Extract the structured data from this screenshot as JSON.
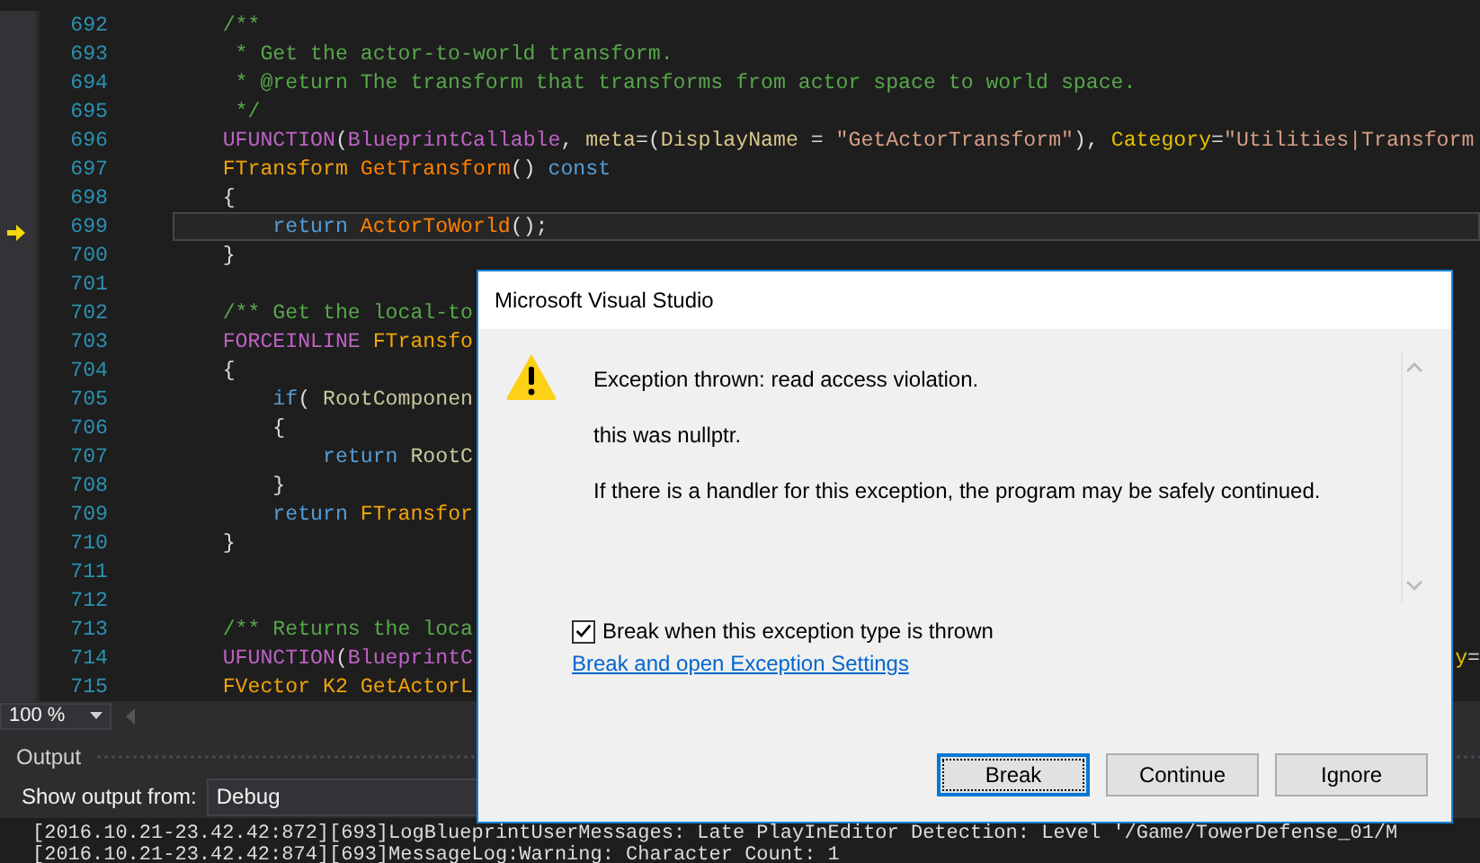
{
  "editor": {
    "lines": [
      {
        "number": "692",
        "tokens": [
          {
            "text": "    /**",
            "kind": "comment"
          }
        ]
      },
      {
        "number": "693",
        "tokens": [
          {
            "text": "     * Get the actor-to-world transform.",
            "kind": "comment"
          }
        ]
      },
      {
        "number": "694",
        "tokens": [
          {
            "text": "     * @return The transform that transforms from actor space to world space.",
            "kind": "comment"
          }
        ]
      },
      {
        "number": "695",
        "tokens": [
          {
            "text": "     */",
            "kind": "comment"
          }
        ]
      },
      {
        "number": "696",
        "tokens": [
          {
            "text": "    UFUNCTION",
            "kind": "macro"
          },
          {
            "text": "(",
            "kind": "plain"
          },
          {
            "text": "BlueprintCallable",
            "kind": "macro"
          },
          {
            "text": ", ",
            "kind": "plain"
          },
          {
            "text": "meta",
            "kind": "attr"
          },
          {
            "text": "=(",
            "kind": "plain"
          },
          {
            "text": "DisplayName",
            "kind": "attr"
          },
          {
            "text": " = ",
            "kind": "plain"
          },
          {
            "text": "\"GetActorTransform\"",
            "kind": "string"
          },
          {
            "text": "), ",
            "kind": "plain"
          },
          {
            "text": "Category",
            "kind": "key"
          },
          {
            "text": "=",
            "kind": "plain"
          },
          {
            "text": "\"Utilities|Transform",
            "kind": "string"
          }
        ]
      },
      {
        "number": "697",
        "tokens": [
          {
            "text": "    FTransform",
            "kind": "type"
          },
          {
            "text": " GetTransform",
            "kind": "function"
          },
          {
            "text": "() ",
            "kind": "plain"
          },
          {
            "text": "const",
            "kind": "keyword"
          }
        ]
      },
      {
        "number": "698",
        "tokens": [
          {
            "text": "    {",
            "kind": "plain"
          }
        ]
      },
      {
        "number": "699",
        "current": true,
        "tokens": [
          {
            "text": "        return",
            "kind": "keyword"
          },
          {
            "text": " ActorToWorld",
            "kind": "function"
          },
          {
            "text": "();",
            "kind": "plain"
          }
        ]
      },
      {
        "number": "700",
        "tokens": [
          {
            "text": "    }",
            "kind": "plain"
          }
        ]
      },
      {
        "number": "701"
      },
      {
        "number": "702",
        "tokens": [
          {
            "text": "    /** Get the local-to",
            "kind": "comment"
          }
        ]
      },
      {
        "number": "703",
        "tokens": [
          {
            "text": "    FORCEINLINE",
            "kind": "macro"
          },
          {
            "text": " FTransfo",
            "kind": "type"
          }
        ]
      },
      {
        "number": "704",
        "tokens": [
          {
            "text": "    {",
            "kind": "plain"
          }
        ]
      },
      {
        "number": "705",
        "tokens": [
          {
            "text": "        if",
            "kind": "keyword"
          },
          {
            "text": "( ",
            "kind": "plain"
          },
          {
            "text": "RootComponen",
            "kind": "variable"
          }
        ]
      },
      {
        "number": "706",
        "tokens": [
          {
            "text": "        {",
            "kind": "plain"
          }
        ]
      },
      {
        "number": "707",
        "tokens": [
          {
            "text": "            return",
            "kind": "keyword"
          },
          {
            "text": " RootC",
            "kind": "variable"
          }
        ]
      },
      {
        "number": "708",
        "tokens": [
          {
            "text": "        }",
            "kind": "plain"
          }
        ]
      },
      {
        "number": "709",
        "tokens": [
          {
            "text": "        return",
            "kind": "keyword"
          },
          {
            "text": " FTransfor",
            "kind": "type"
          }
        ]
      },
      {
        "number": "710",
        "tokens": [
          {
            "text": "    }",
            "kind": "plain"
          }
        ]
      },
      {
        "number": "711"
      },
      {
        "number": "712"
      },
      {
        "number": "713",
        "tokens": [
          {
            "text": "    /** Returns the loca",
            "kind": "comment"
          }
        ]
      },
      {
        "number": "714",
        "tokens": [
          {
            "text": "    UFUNCTION",
            "kind": "macro"
          },
          {
            "text": "(",
            "kind": "plain"
          },
          {
            "text": "BlueprintC",
            "kind": "macro"
          }
        ],
        "tail": [
          {
            "text": "y",
            "kind": "key"
          },
          {
            "text": "=",
            "kind": "plain"
          }
        ]
      },
      {
        "number": "715",
        "tokens": [
          {
            "text": "    FVector K2 GetActorL",
            "kind": "type"
          }
        ]
      }
    ],
    "zoom": "100 %"
  },
  "output": {
    "title": "Output",
    "source_label": "Show output from:",
    "source": "Debug",
    "lines": [
      "[2016.10.21-23.42.42:872][693]LogBlueprintUserMessages: Late PlayInEditor Detection: Level '/Game/TowerDefense_01/M",
      "[2016.10.21-23.42.42:874][693]MessageLog:Warning: Character Count: 1"
    ]
  },
  "dialog": {
    "title": "Microsoft Visual Studio",
    "messages": [
      "Exception thrown: read access violation.",
      "this was nullptr.",
      "If there is a handler for this exception, the program may be safely continued."
    ],
    "checkbox": {
      "label": "Break when this exception type is thrown",
      "checked": true
    },
    "link": "Break and open Exception Settings",
    "buttons": [
      {
        "label": "Break",
        "default": true
      },
      {
        "label": "Continue",
        "default": false
      },
      {
        "label": "Ignore",
        "default": false
      }
    ]
  }
}
